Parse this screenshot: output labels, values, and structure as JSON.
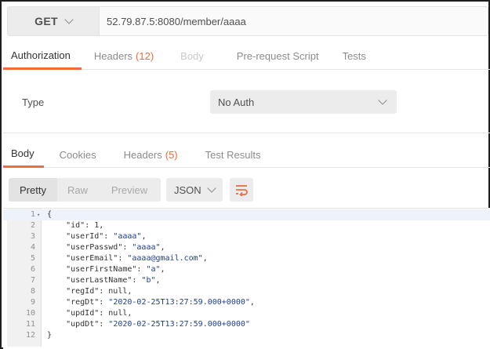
{
  "request": {
    "method": "GET",
    "url": "52.79.87.5:8080/member/aaaa"
  },
  "request_tabs": [
    {
      "label": "Authorization",
      "count": "",
      "state": "active"
    },
    {
      "label": "Headers",
      "count": "(12)",
      "state": "normal"
    },
    {
      "label": "Body",
      "count": "",
      "state": "disabled"
    },
    {
      "label": "Pre-request Script",
      "count": "",
      "state": "normal"
    },
    {
      "label": "Tests",
      "count": "",
      "state": "normal"
    }
  ],
  "auth": {
    "type_label": "Type",
    "type_value": "No Auth"
  },
  "response_tabs": [
    {
      "label": "Body",
      "count": "",
      "state": "active"
    },
    {
      "label": "Cookies",
      "count": "",
      "state": "normal"
    },
    {
      "label": "Headers",
      "count": "(5)",
      "state": "normal"
    },
    {
      "label": "Test Results",
      "count": "",
      "state": "normal"
    }
  ],
  "view_modes": [
    {
      "label": "Pretty",
      "active": true
    },
    {
      "label": "Raw",
      "active": false
    },
    {
      "label": "Preview",
      "active": false
    }
  ],
  "format": "JSON",
  "icons": {
    "method_dropdown": "chevron-down-icon",
    "auth_dropdown": "chevron-down-icon",
    "format_dropdown": "chevron-down-icon",
    "wrap": "wrap-lines-icon",
    "fold": "fold-arrow-icon"
  },
  "colors": {
    "accent": "#f26b3a",
    "string": "#1f3f94"
  },
  "code_lines": [
    {
      "n": "1",
      "parts": [
        [
          "p",
          "{"
        ]
      ]
    },
    {
      "n": "2",
      "parts": [
        [
          "p",
          "    "
        ],
        [
          "k",
          "\"id\""
        ],
        [
          "p",
          ": 1,"
        ]
      ]
    },
    {
      "n": "3",
      "parts": [
        [
          "p",
          "    "
        ],
        [
          "k",
          "\"userId\""
        ],
        [
          "p",
          ": "
        ],
        [
          "s",
          "\"aaaa\""
        ],
        [
          "p",
          ","
        ]
      ]
    },
    {
      "n": "4",
      "parts": [
        [
          "p",
          "    "
        ],
        [
          "k",
          "\"userPasswd\""
        ],
        [
          "p",
          ": "
        ],
        [
          "s",
          "\"aaaa\""
        ],
        [
          "p",
          ","
        ]
      ]
    },
    {
      "n": "5",
      "parts": [
        [
          "p",
          "    "
        ],
        [
          "k",
          "\"userEmail\""
        ],
        [
          "p",
          ": "
        ],
        [
          "s",
          "\"aaaa@gmail.com\""
        ],
        [
          "p",
          ","
        ]
      ]
    },
    {
      "n": "6",
      "parts": [
        [
          "p",
          "    "
        ],
        [
          "k",
          "\"userFirstName\""
        ],
        [
          "p",
          ": "
        ],
        [
          "s",
          "\"a\""
        ],
        [
          "p",
          ","
        ]
      ]
    },
    {
      "n": "7",
      "parts": [
        [
          "p",
          "    "
        ],
        [
          "k",
          "\"userLastName\""
        ],
        [
          "p",
          ": "
        ],
        [
          "s",
          "\"b\""
        ],
        [
          "p",
          ","
        ]
      ]
    },
    {
      "n": "8",
      "parts": [
        [
          "p",
          "    "
        ],
        [
          "k",
          "\"regId\""
        ],
        [
          "p",
          ": null,"
        ]
      ]
    },
    {
      "n": "9",
      "parts": [
        [
          "p",
          "    "
        ],
        [
          "k",
          "\"regDt\""
        ],
        [
          "p",
          ": "
        ],
        [
          "s",
          "\"2020-02-25T13:27:59.000+0000\""
        ],
        [
          "p",
          ","
        ]
      ]
    },
    {
      "n": "10",
      "parts": [
        [
          "p",
          "    "
        ],
        [
          "k",
          "\"updId\""
        ],
        [
          "p",
          ": null,"
        ]
      ]
    },
    {
      "n": "11",
      "parts": [
        [
          "p",
          "    "
        ],
        [
          "k",
          "\"updDt\""
        ],
        [
          "p",
          ": "
        ],
        [
          "s",
          "\"2020-02-25T13:27:59.000+0000\""
        ]
      ]
    },
    {
      "n": "12",
      "parts": [
        [
          "p",
          "}"
        ]
      ]
    }
  ]
}
